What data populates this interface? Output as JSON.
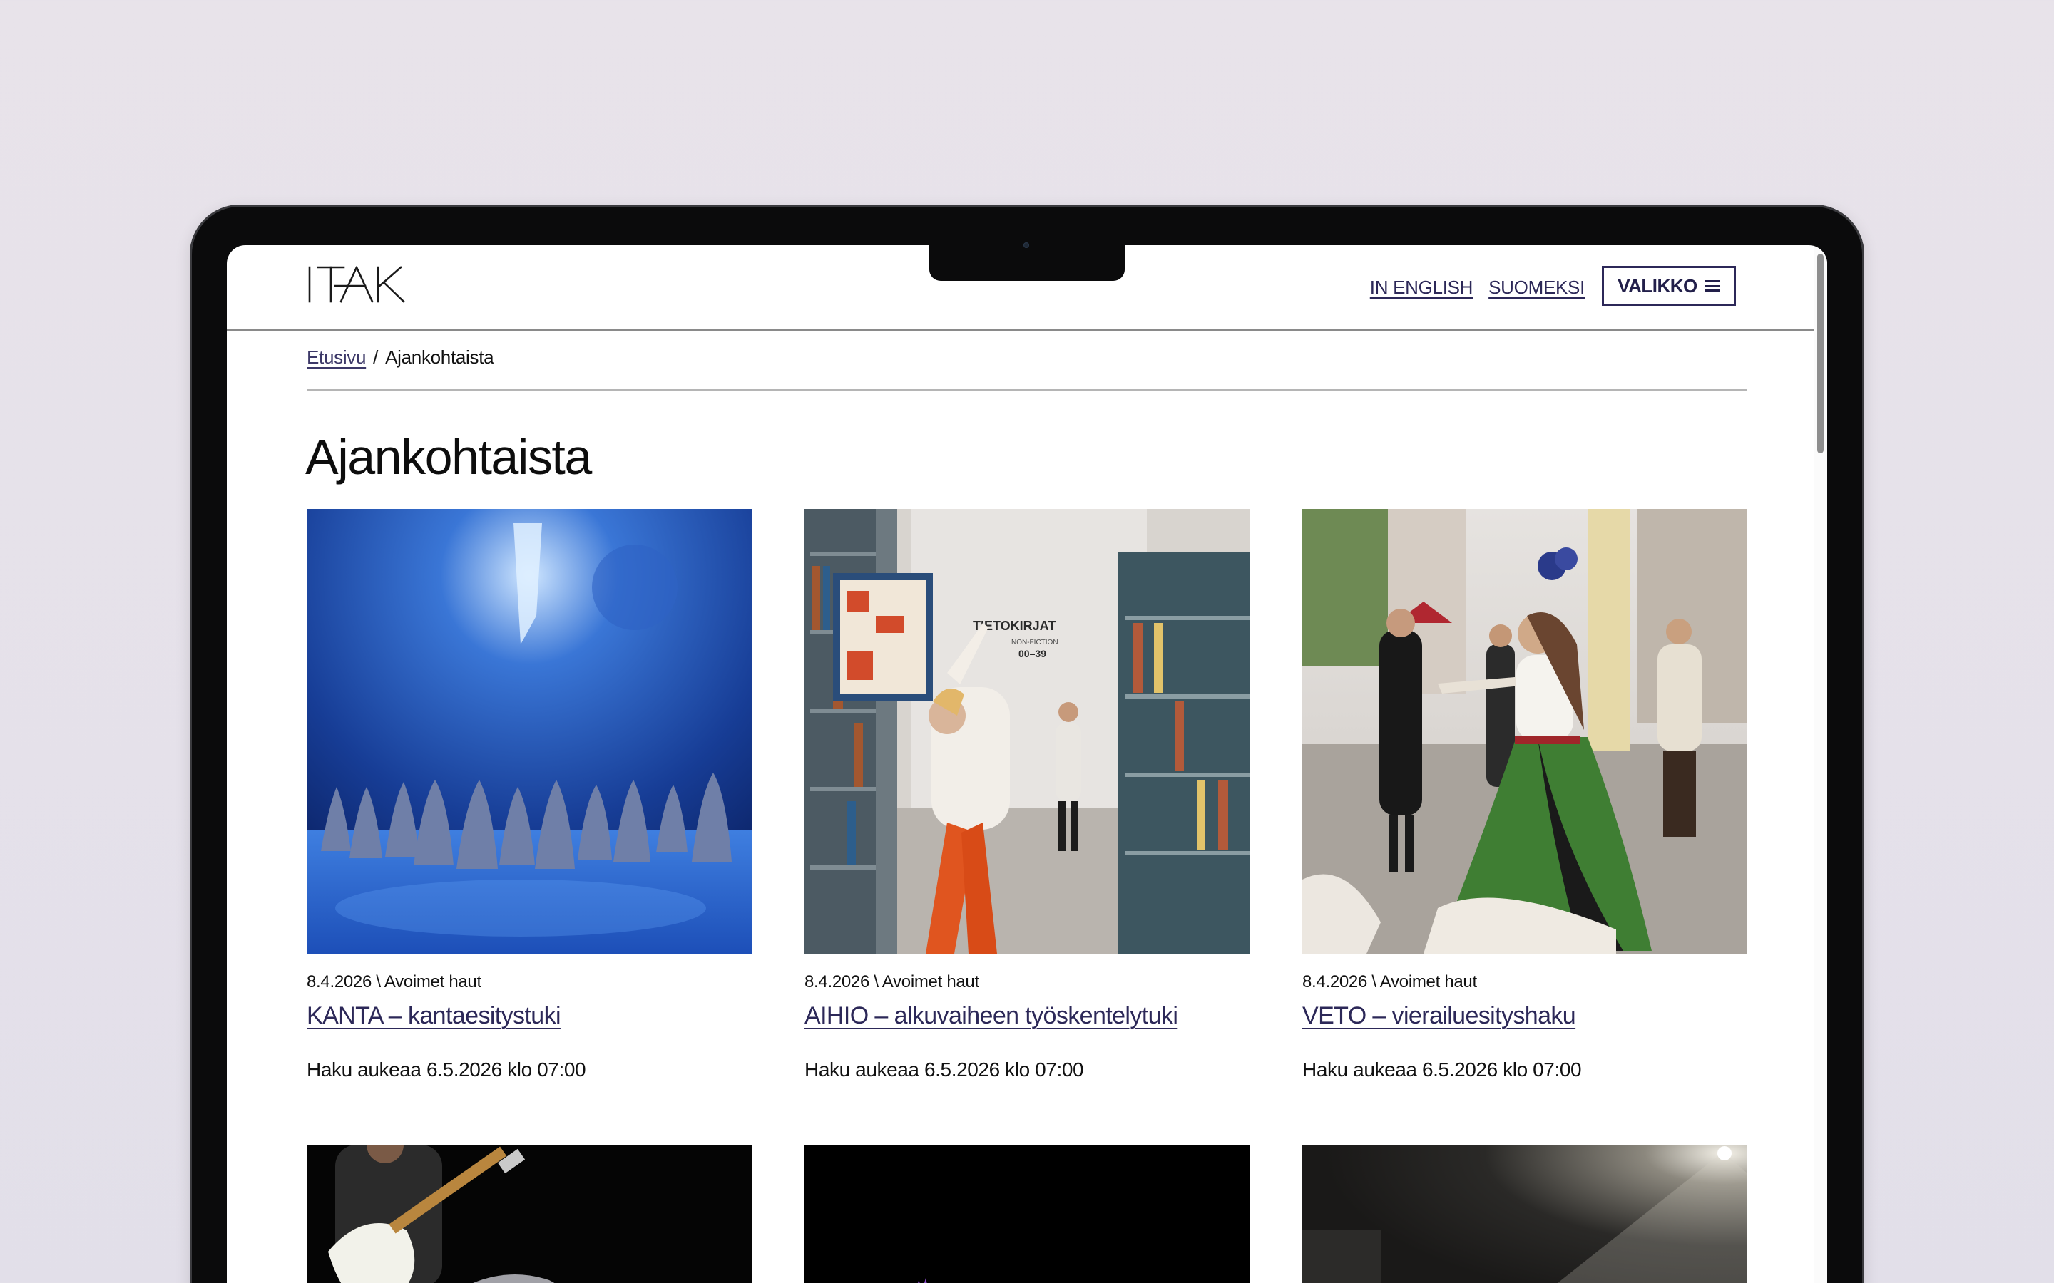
{
  "header": {
    "logo_text": "ITAK",
    "lang_english": "IN ENGLISH",
    "lang_finnish": "SUOMEKSI",
    "menu_label": "VALIKKO"
  },
  "breadcrumb": {
    "home": "Etusivu",
    "separator": "/",
    "current": "Ajankohtaista"
  },
  "page": {
    "title": "Ajankohtaista"
  },
  "articles": [
    {
      "meta": "8.4.2026 \\ Avoimet haut",
      "title": "KANTA – kantaesitystuki",
      "description": "Haku aukeaa 6.5.2026 klo 07:00",
      "image": "blue-stage-chorus"
    },
    {
      "meta": "8.4.2026 \\ Avoimet haut",
      "title": "AIHIO – alkuvaiheen työskentelytuki",
      "description": "Haku aukeaa 6.5.2026 klo 07:00",
      "image": "library-dancer",
      "image_sign": "TIETOKIRJAT",
      "image_sign_sub": "NON-FICTION",
      "image_sign_range": "00–39"
    },
    {
      "meta": "8.4.2026 \\ Avoimet haut",
      "title": "VETO – vierailuesityshaku",
      "description": "Haku aukeaa 6.5.2026 klo 07:00",
      "image": "street-performer"
    },
    {
      "image": "guitar-performer"
    },
    {
      "image": "dark-stage-purple"
    },
    {
      "image": "spotlit-stage"
    }
  ],
  "colors": {
    "link": "#2c2858",
    "background": "#ffffff",
    "frame": "#0b0b0c"
  }
}
